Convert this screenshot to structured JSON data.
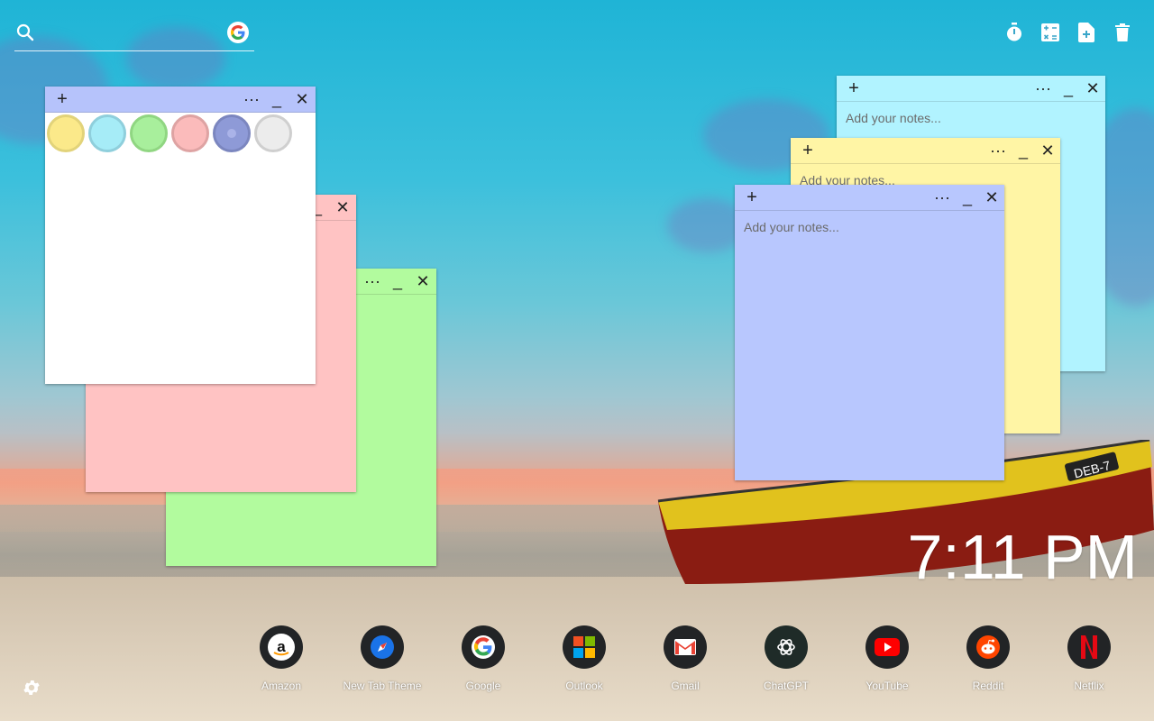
{
  "search": {
    "placeholder": ""
  },
  "top_tools": [
    {
      "name": "timer-icon"
    },
    {
      "name": "calculator-icon"
    },
    {
      "name": "new-note-icon"
    },
    {
      "name": "trash-icon"
    }
  ],
  "notes": {
    "palette_note": {
      "bg": "#ffffff",
      "bar": "#b6c3fb",
      "swatches": [
        "#fbe98a",
        "#a6ecf7",
        "#a8ef9c",
        "#fbbbbb",
        "#8e9ad7",
        "#ececec"
      ]
    },
    "pink_note": {
      "bg": "#ffc3c3",
      "bar": "#ffc3c3"
    },
    "green_note": {
      "bg": "#b2fb9e",
      "bar": "#b2fb9e"
    },
    "cyan_note": {
      "bg": "#b1f3ff",
      "placeholder": "Add your notes..."
    },
    "yellow_note": {
      "bg": "#fff5a5",
      "placeholder": "Add your notes..."
    },
    "blue_note": {
      "bg": "#b8c7fe",
      "placeholder": "Add your notes..."
    }
  },
  "clock": {
    "time": "7:11 PM"
  },
  "dock": [
    {
      "label": "Amazon"
    },
    {
      "label": "New Tab Theme"
    },
    {
      "label": "Google"
    },
    {
      "label": "Outlook"
    },
    {
      "label": "Gmail"
    },
    {
      "label": "ChatGPT"
    },
    {
      "label": "YouTube"
    },
    {
      "label": "Reddit"
    },
    {
      "label": "Netflix"
    }
  ],
  "boat": {
    "marking": "DEB-7"
  }
}
